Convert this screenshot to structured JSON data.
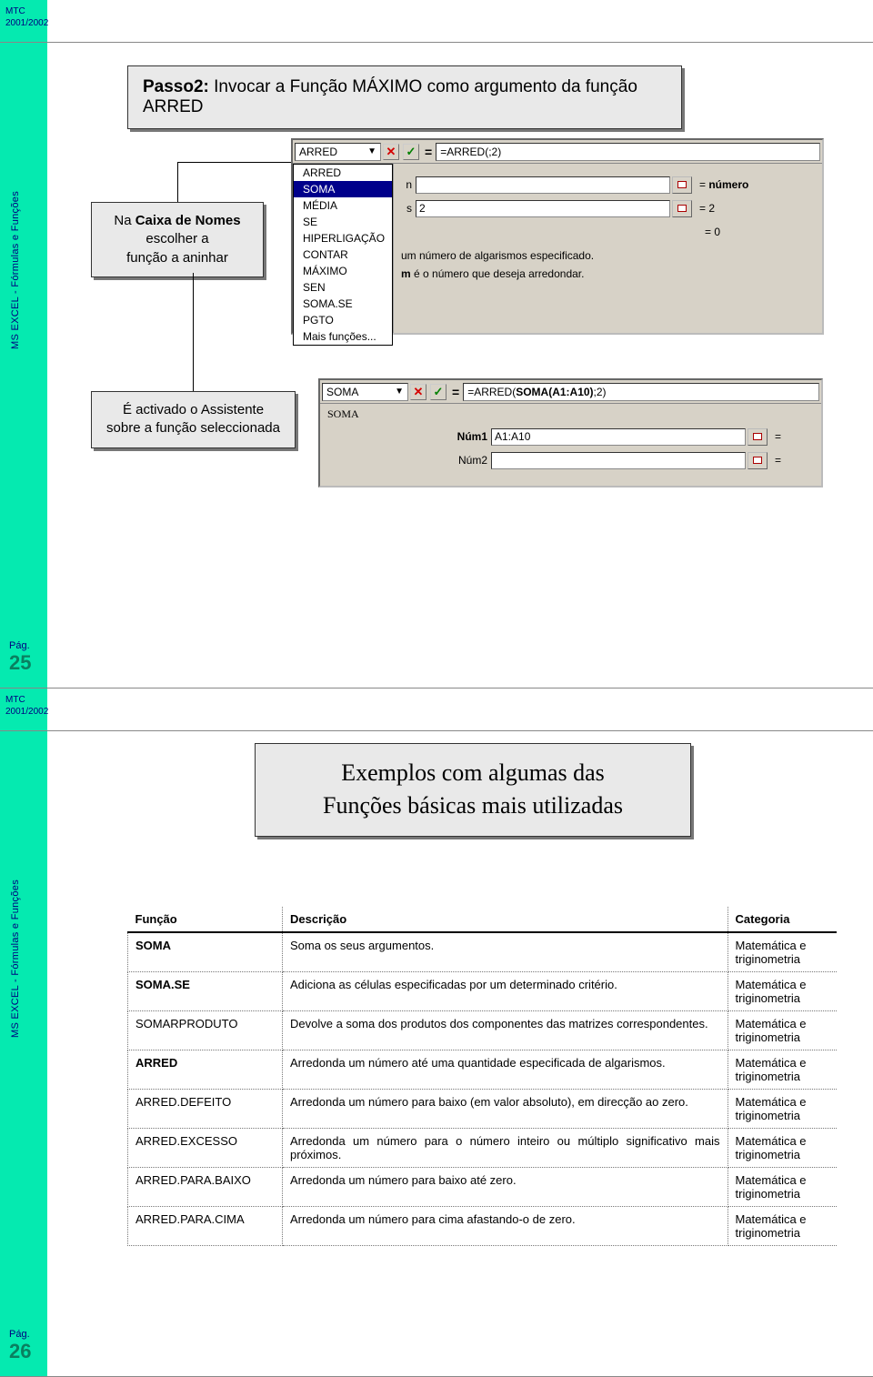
{
  "header": {
    "mtc_line1": "MTC",
    "mtc_line2": "2001/2002"
  },
  "sidebar": {
    "vertical_text": "MS EXCEL - Fórmulas e Funções",
    "page_label": "Pág."
  },
  "slide1": {
    "page_number": "25",
    "title_prefix": "Passo2:",
    "title_rest": "  Invocar a Função MÁXIMO como argumento da função ARRED",
    "callA_line1": "Na ",
    "callA_bold": "Caixa de Nomes",
    "callA_line2": "escolher a",
    "callA_line3": "função a aninhar",
    "callB_line1": "É activado o Assistente",
    "callB_line2": "sobre a função seleccionada",
    "formulaBar1": {
      "name": "ARRED",
      "formula": "=ARRED(;2)"
    },
    "dropdown_items": [
      "ARRED",
      "SOMA",
      "MÉDIA",
      "SE",
      "HIPERLIGAÇÃO",
      "CONTAR",
      "MÁXIMO",
      "SEN",
      "SOMA.SE",
      "PGTO",
      "Mais funções..."
    ],
    "dropdown_selected_index": 1,
    "wizard1": {
      "arg1_label": "n",
      "arg1_value": "",
      "arg1_result": "número",
      "arg2_label": "s",
      "arg2_value": "2",
      "arg2_result": "2",
      "overall_result": "0",
      "help1": "um número de algarismos especificado.",
      "help2a": "m",
      "help2b": "  é o número que deseja arredondar."
    },
    "formulaBar2": {
      "name": "SOMA",
      "formula": "=ARRED(SOMA(A1:A10);2)"
    },
    "wizard2": {
      "title": "SOMA",
      "arg1_label": "Núm1",
      "arg1_value": "A1:A10",
      "arg2_label": "Núm2",
      "arg2_value": ""
    }
  },
  "slide2": {
    "page_number": "26",
    "title_line1": "Exemplos com algumas das",
    "title_line2": "Funções básicas mais utilizadas",
    "columns": {
      "func": "Função",
      "desc": "Descrição",
      "cat": "Categoria"
    },
    "rows": [
      {
        "func": "SOMA",
        "bold": true,
        "desc": "Soma os seus argumentos.",
        "cat": "Matemática e triginometria"
      },
      {
        "func": "SOMA.SE",
        "bold": true,
        "desc": "Adiciona as células especificadas por um determinado critério.",
        "cat": "Matemática e triginometria"
      },
      {
        "func": "SOMARPRODUTO",
        "bold": false,
        "desc": "Devolve a soma dos produtos dos componentes das matrizes correspondentes.",
        "cat": "Matemática e triginometria"
      },
      {
        "func": "ARRED",
        "bold": true,
        "desc": "Arredonda um número até uma quantidade especificada de algarismos.",
        "cat": "Matemática e triginometria"
      },
      {
        "func": "ARRED.DEFEITO",
        "bold": false,
        "desc": "Arredonda um número para baixo (em valor absoluto), em direcção ao zero.",
        "cat": "Matemática e triginometria"
      },
      {
        "func": "ARRED.EXCESSO",
        "bold": false,
        "desc": "Arredonda um número para o número inteiro ou múltiplo significativo mais próximos.",
        "cat": "Matemática e triginometria"
      },
      {
        "func": "ARRED.PARA.BAIXO",
        "bold": false,
        "desc": "Arredonda um número para baixo até zero.",
        "cat": "Matemática e triginometria"
      },
      {
        "func": "ARRED.PARA.CIMA",
        "bold": false,
        "desc": "Arredonda um número para cima afastando-o de zero.",
        "cat": "Matemática e triginometria"
      }
    ]
  }
}
